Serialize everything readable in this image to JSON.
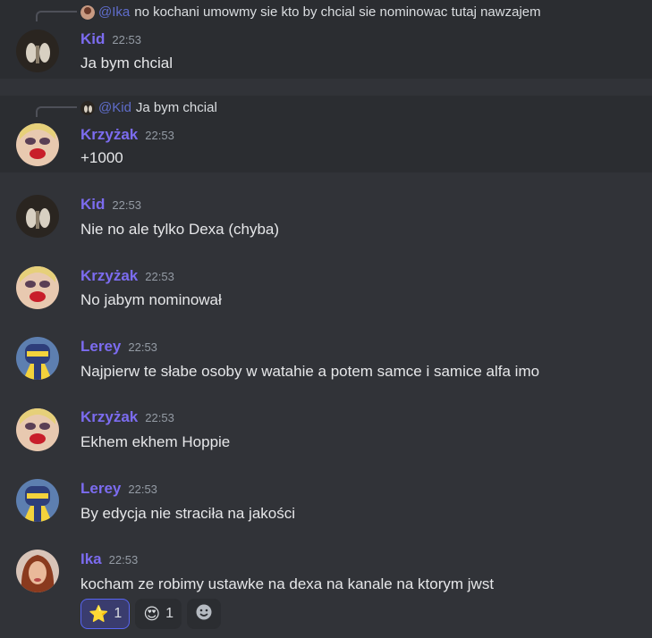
{
  "messages": [
    {
      "reply": {
        "mention": "@Ika",
        "text": "no kochani umowmy sie kto by chcial sie nominowac tutaj  nawzajem"
      },
      "author": "Kid",
      "time": "22:53",
      "text": "Ja bym chcial"
    },
    {
      "reply": {
        "mention": "@Kid",
        "text": "Ja bym chcial"
      },
      "author": "Krzyżak",
      "time": "22:53",
      "text": "+1000"
    },
    {
      "author": "Kid",
      "time": "22:53",
      "text": "Nie no ale tylko Dexa (chyba)"
    },
    {
      "author": "Krzyżak",
      "time": "22:53",
      "text": "No jabym nominował"
    },
    {
      "author": "Lerey",
      "time": "22:53",
      "text": "Najpierw te słabe osoby w watahie a potem samce i samice alfa imo"
    },
    {
      "author": "Krzyżak",
      "time": "22:53",
      "text": "Ekhem ekhem Hoppie"
    },
    {
      "author": "Lerey",
      "time": "22:53",
      "text": "By edycja nie straciła na jakości"
    },
    {
      "author": "Ika",
      "time": "22:53",
      "text": "kocham ze robimy ustawke na dexa na kanale na ktorym jwst"
    }
  ],
  "reactions": [
    {
      "emoji": "⭐",
      "count": "1"
    },
    {
      "emoji": "😍",
      "count": "1"
    }
  ],
  "colors": {
    "username": "#7c6cf0",
    "mention": "#6d7ef2",
    "background": "#313338",
    "highlight": "#2b2d31"
  }
}
